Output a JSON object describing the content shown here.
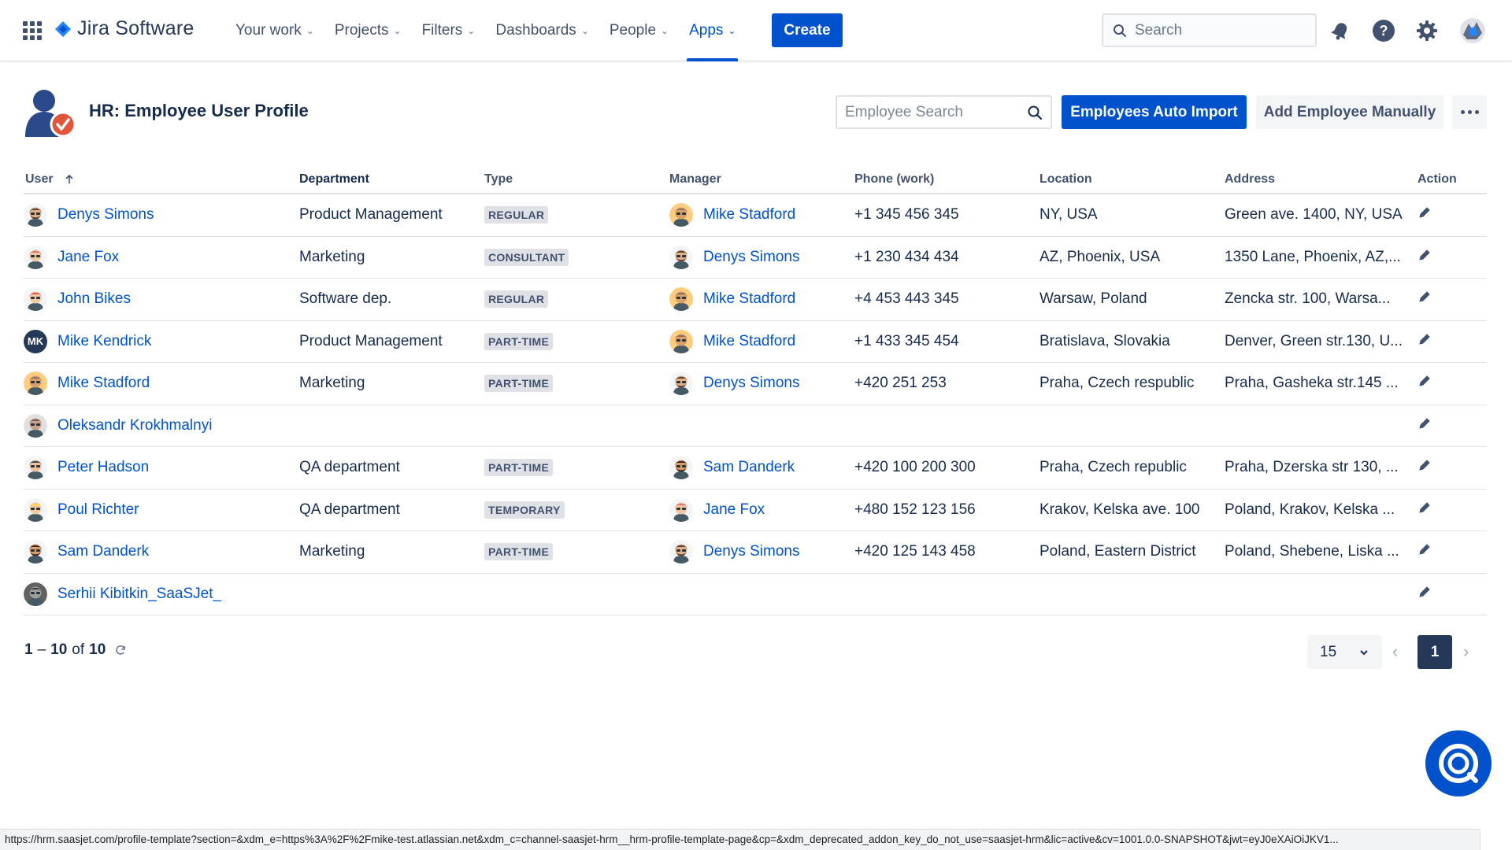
{
  "nav": {
    "brand": "Jira Software",
    "items": [
      {
        "label": "Your work",
        "active": false
      },
      {
        "label": "Projects",
        "active": false
      },
      {
        "label": "Filters",
        "active": false
      },
      {
        "label": "Dashboards",
        "active": false
      },
      {
        "label": "People",
        "active": false
      },
      {
        "label": "Apps",
        "active": true
      }
    ],
    "create_label": "Create",
    "search_placeholder": "Search",
    "icons": [
      "notification-icon",
      "help-icon",
      "settings-icon",
      "profile-avatar"
    ]
  },
  "page": {
    "title": "HR: Employee User Profile",
    "employee_search_placeholder": "Employee Search",
    "auto_import_label": "Employees Auto Import",
    "add_manual_label": "Add Employee Manually"
  },
  "table": {
    "headers": {
      "user": "User",
      "department": "Department",
      "type": "Type",
      "manager": "Manager",
      "phone": "Phone (work)",
      "location": "Location",
      "address": "Address",
      "action": "Action"
    },
    "sort": {
      "column": "user",
      "direction": "ascending"
    },
    "rows": [
      {
        "user": "Denys Simons",
        "department": "Product Management",
        "type": "REGULAR",
        "manager": "Mike Stadford",
        "phone": "+1 345 456 345",
        "location": "NY, USA",
        "address": "Green ave. 1400, NY, USA"
      },
      {
        "user": "Jane Fox",
        "department": "Marketing",
        "type": "CONSULTANT",
        "manager": "Denys Simons",
        "phone": "+1 230 434 434",
        "location": "AZ, Phoenix, USA",
        "address": "1350 Lane, Phoenix, AZ,..."
      },
      {
        "user": "John Bikes",
        "department": "Software dep.",
        "type": "REGULAR",
        "manager": "Mike Stadford",
        "phone": "+4 453 443 345",
        "location": "Warsaw, Poland",
        "address": "Zencka str. 100, Warsa..."
      },
      {
        "user": "Mike Kendrick",
        "avatar_initials": "MK",
        "department": "Product Management",
        "type": "PART-TIME",
        "manager": "Mike Stadford",
        "phone": "+1 433 345 454",
        "location": "Bratislava, Slovakia",
        "address": "Denver, Green str.130, U..."
      },
      {
        "user": "Mike Stadford",
        "department": "Marketing",
        "type": "PART-TIME",
        "manager": "Denys Simons",
        "phone": "+420 251 253",
        "location": "Praha, Czech respublic",
        "address": "Praha, Gasheka str.145 ..."
      },
      {
        "user": "Oleksandr Krokhmalnyi",
        "department": "",
        "type": "",
        "manager": "",
        "phone": "",
        "location": "",
        "address": ""
      },
      {
        "user": "Peter Hadson",
        "department": "QA department",
        "type": "PART-TIME",
        "manager": "Sam Danderk",
        "phone": "+420 100 200 300",
        "location": "Praha, Czech republic",
        "address": "Praha, Dzerska str 130, ..."
      },
      {
        "user": "Poul Richter",
        "department": "QA department",
        "type": "TEMPORARY",
        "manager": "Jane Fox",
        "phone": "+480 152 123 156",
        "location": "Krakov, Kelska ave. 100",
        "address": "Poland, Krakov, Kelska ..."
      },
      {
        "user": "Sam Danderk",
        "department": "Marketing",
        "type": "PART-TIME",
        "manager": "Denys Simons",
        "phone": "+420 125 143 458",
        "location": "Poland, Eastern District",
        "address": "Poland, Shebene, Liska ..."
      },
      {
        "user": "Serhii Kibitkin_SaaSJet_",
        "department": "",
        "type": "",
        "manager": "",
        "phone": "",
        "location": "",
        "address": ""
      }
    ]
  },
  "pagination": {
    "range_start": "1",
    "range_end": "10",
    "of_label": "of",
    "total": "10",
    "per_page": "15",
    "current_page": "1"
  },
  "status_url": "https://hrm.saasjet.com/profile-template?section=&xdm_e=https%3A%2F%2Fmike-test.atlassian.net&xdm_c=channel-saasjet-hrm__hrm-profile-template-page&cp=&xdm_deprecated_addon_key_do_not_use=saasjet-hrm&lic=active&cv=1001.0.0-SNAPSHOT&jwt=eyJ0eXAiOiJKV1...",
  "colors": {
    "primary": "#0052cc",
    "text": "#172b4d",
    "muted": "#42526e",
    "lozenge_bg": "#dfe1e6"
  }
}
